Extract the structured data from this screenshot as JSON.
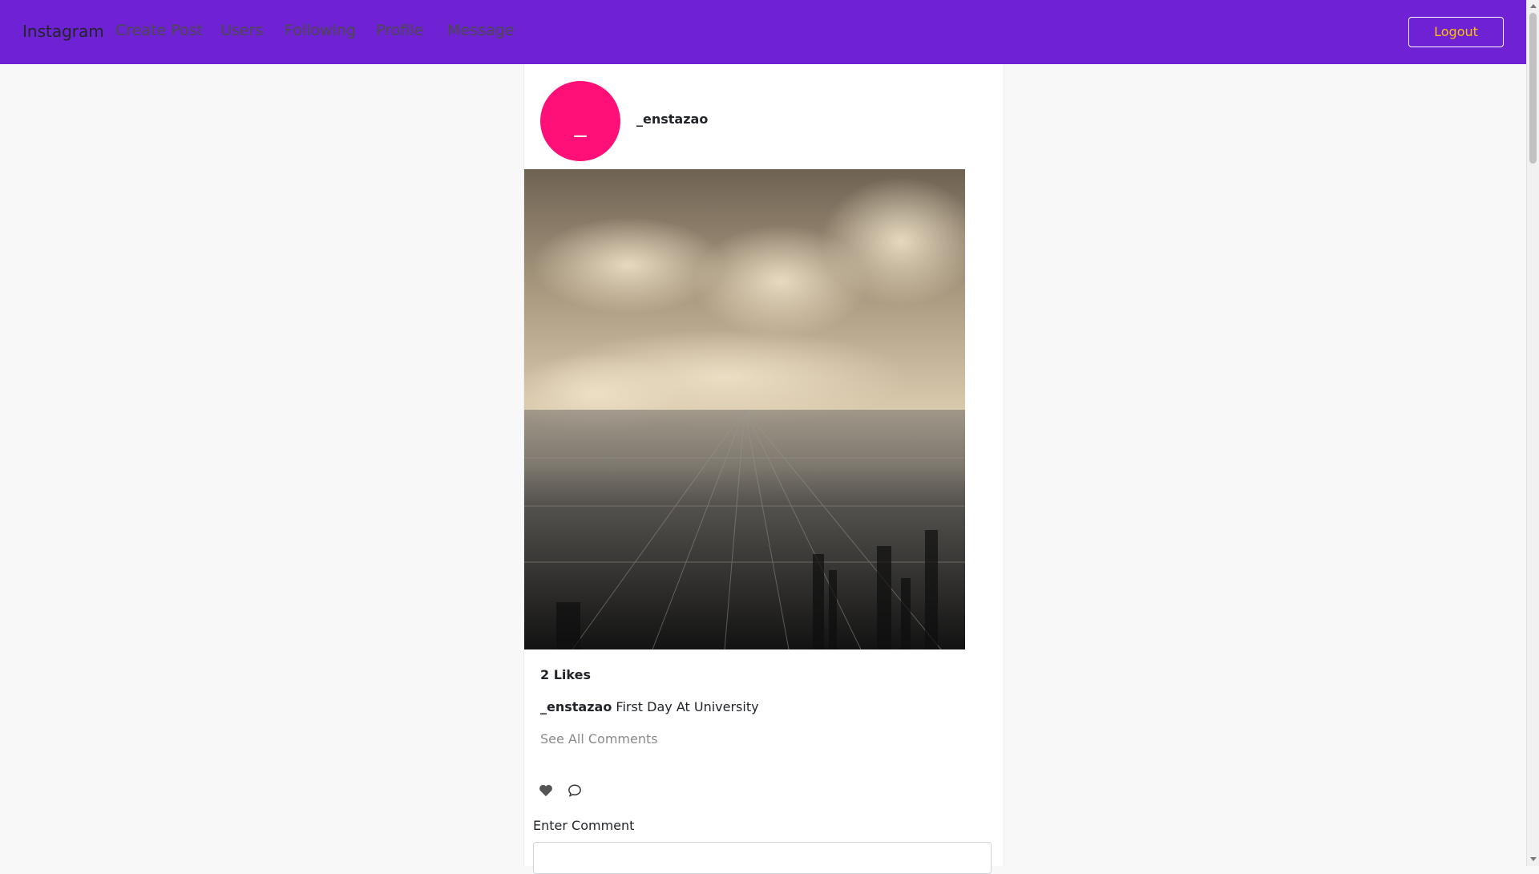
{
  "navbar": {
    "brand": "Instagram",
    "links": [
      "Create Post",
      "Users",
      "Following",
      "Profile",
      "Message"
    ],
    "logout_label": "Logout",
    "background_color": "#6f22d3",
    "logout_color": "#ffc107"
  },
  "post": {
    "avatar_letter": "_",
    "avatar_color": "#ff0f78",
    "username": "_enstazao",
    "likes_text": "2 Likes",
    "caption_user": "_enstazao",
    "caption_text": "First Day At University",
    "see_all_comments": "See All Comments",
    "like_icon": "heart-icon",
    "comment_icon": "comment-icon",
    "comment_label": "Enter Comment",
    "comment_value": ""
  }
}
